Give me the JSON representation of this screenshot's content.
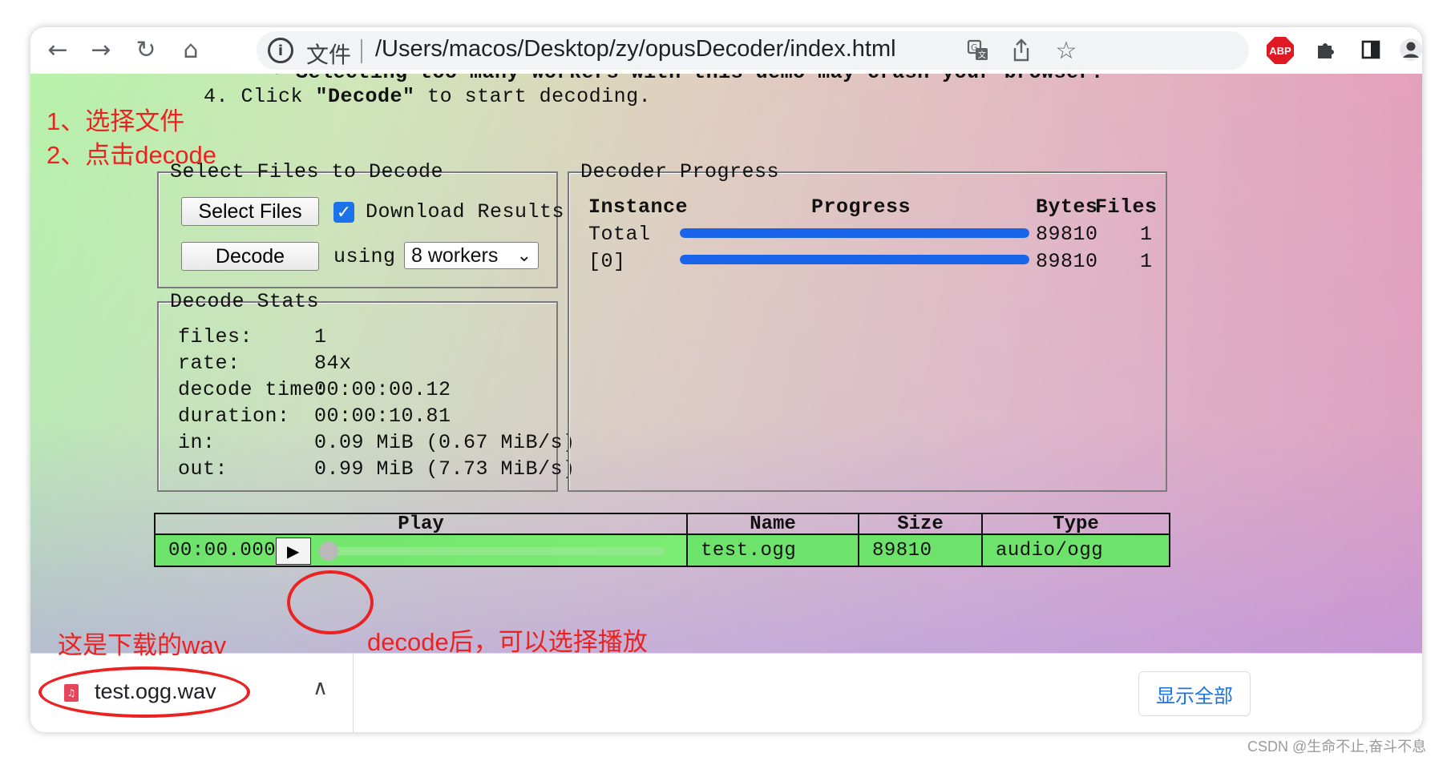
{
  "browser": {
    "omnibox_label": "文件",
    "url": "/Users/macos/Desktop/zy/opusDecoder/index.html",
    "abp_label": "ABP"
  },
  "page": {
    "instruction_cut": "◦ Selecting too many workers with this demo may crash your browser.",
    "instruction_4_prefix": "4. Click ",
    "instruction_4_bold": "\"Decode\"",
    "instruction_4_suffix": " to start decoding.",
    "select_files": {
      "legend": "Select Files to Decode",
      "select_button": "Select Files",
      "download_results_label": "Download Results",
      "download_results_checked": true,
      "decode_button": "Decode",
      "using_label": "using",
      "workers_value": "8 workers"
    },
    "decode_stats": {
      "legend": "Decode Stats",
      "rows": [
        {
          "key": "files:",
          "value": "1"
        },
        {
          "key": "rate:",
          "value": "84x"
        },
        {
          "key": "decode time:",
          "value": "00:00:00.12"
        },
        {
          "key": "duration:",
          "value": "00:00:10.81"
        },
        {
          "key": "in:",
          "value": "0.09 MiB (0.67 MiB/s)"
        },
        {
          "key": "out:",
          "value": "0.99 MiB (7.73 MiB/s)"
        }
      ]
    },
    "decoder_progress": {
      "legend": "Decoder Progress",
      "headers": {
        "instance": "Instance",
        "progress": "Progress",
        "bytes": "Bytes",
        "files": "Files"
      },
      "rows": [
        {
          "instance": "Total",
          "progress": 1.0,
          "bytes": "89810",
          "files": "1"
        },
        {
          "instance": "[0]",
          "progress": 1.0,
          "bytes": "89810",
          "files": "1"
        }
      ]
    },
    "files_table": {
      "headers": {
        "play": "Play",
        "name": "Name",
        "size": "Size",
        "type": "Type"
      },
      "row": {
        "time": "00:00.000",
        "name": "test.ogg",
        "size": "89810",
        "type": "audio/ogg",
        "seek_progress": 0.0
      }
    }
  },
  "downloads": {
    "file_name": "test.ogg.wav",
    "show_all": "显示全部"
  },
  "annotations": {
    "step1": "1、选择文件",
    "step2": "2、点击decode",
    "downloaded": "这是下载的wav",
    "after_decode": "decode后，可以选择播放",
    "color": "#ec2222"
  },
  "watermark": "CSDN @生命不止,奋斗不息",
  "colors": {
    "progress_fill": "#1a64ea",
    "row_green": "#6ee36b",
    "checkbox_blue": "#1a73e8"
  }
}
